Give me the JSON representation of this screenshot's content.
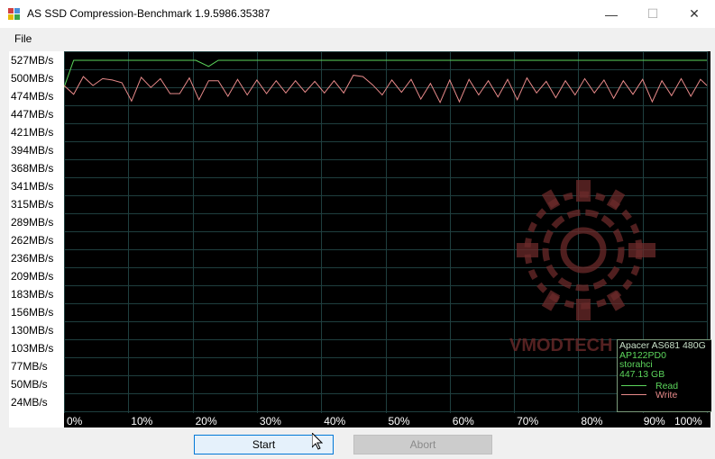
{
  "window": {
    "title": "AS SSD Compression-Benchmark 1.9.5986.35387",
    "minimize_glyph": "—",
    "maximize_glyph": "☐",
    "close_glyph": "✕"
  },
  "menu": {
    "file_label": "File"
  },
  "watermark": {
    "text": "VMODTECH"
  },
  "chart_data": {
    "type": "line",
    "y_tick_labels": [
      "527MB/s",
      "500MB/s",
      "474MB/s",
      "447MB/s",
      "421MB/s",
      "394MB/s",
      "368MB/s",
      "341MB/s",
      "315MB/s",
      "289MB/s",
      "262MB/s",
      "236MB/s",
      "209MB/s",
      "183MB/s",
      "156MB/s",
      "130MB/s",
      "103MB/s",
      "77MB/s",
      "50MB/s",
      "24MB/s"
    ],
    "x_tick_labels": [
      "0%",
      "10%",
      "20%",
      "30%",
      "40%",
      "50%",
      "60%",
      "70%",
      "80%",
      "90%",
      "100%"
    ],
    "ylim": [
      0,
      540
    ],
    "xlim": [
      0,
      100
    ],
    "grid": true,
    "legend_position": "bottom-right",
    "series": [
      {
        "name": "Read",
        "color": "#5cd65c",
        "x": [
          0,
          1.5,
          20.5,
          22.5,
          24,
          100
        ],
        "y": [
          487,
          527,
          527,
          518,
          527,
          527
        ]
      },
      {
        "name": "Write",
        "color": "#e88a8a",
        "x": [
          0,
          1.5,
          3,
          4.5,
          6,
          7.5,
          9,
          10.5,
          12,
          13.5,
          15,
          16.5,
          18,
          19.5,
          21,
          22.5,
          24,
          25.5,
          27,
          28.5,
          30,
          31.5,
          33,
          34.5,
          36,
          37.5,
          39,
          40.5,
          42,
          43.5,
          45,
          46.5,
          48,
          49.5,
          51,
          52.5,
          54,
          55.5,
          57,
          58.5,
          60,
          61.5,
          63,
          64.5,
          66,
          67.5,
          69,
          70.5,
          72,
          73.5,
          75,
          76.5,
          78,
          79.5,
          81,
          82.5,
          84,
          85.5,
          87,
          88.5,
          90,
          91.5,
          93,
          94.5,
          96,
          97.5,
          99,
          100
        ],
        "y": [
          490,
          477,
          503,
          490,
          500,
          498,
          494,
          467,
          502,
          487,
          500,
          478,
          478,
          501,
          469,
          497,
          497,
          474,
          499,
          476,
          498,
          478,
          497,
          479,
          497,
          480,
          496,
          479,
          497,
          479,
          505,
          503,
          491,
          476,
          498,
          480,
          499,
          470,
          493,
          465,
          498,
          466,
          499,
          476,
          497,
          473,
          499,
          469,
          501,
          479,
          496,
          472,
          497,
          476,
          500,
          479,
          498,
          471,
          497,
          477,
          499,
          466,
          497,
          475,
          500,
          474,
          499,
          490
        ]
      }
    ],
    "device": {
      "model": "Apacer AS681 480G",
      "firmware": "AP122PD0",
      "driver": "storahci",
      "capacity": "447.13 GB"
    }
  },
  "buttons": {
    "start_label": "Start",
    "abort_label": "Abort"
  }
}
